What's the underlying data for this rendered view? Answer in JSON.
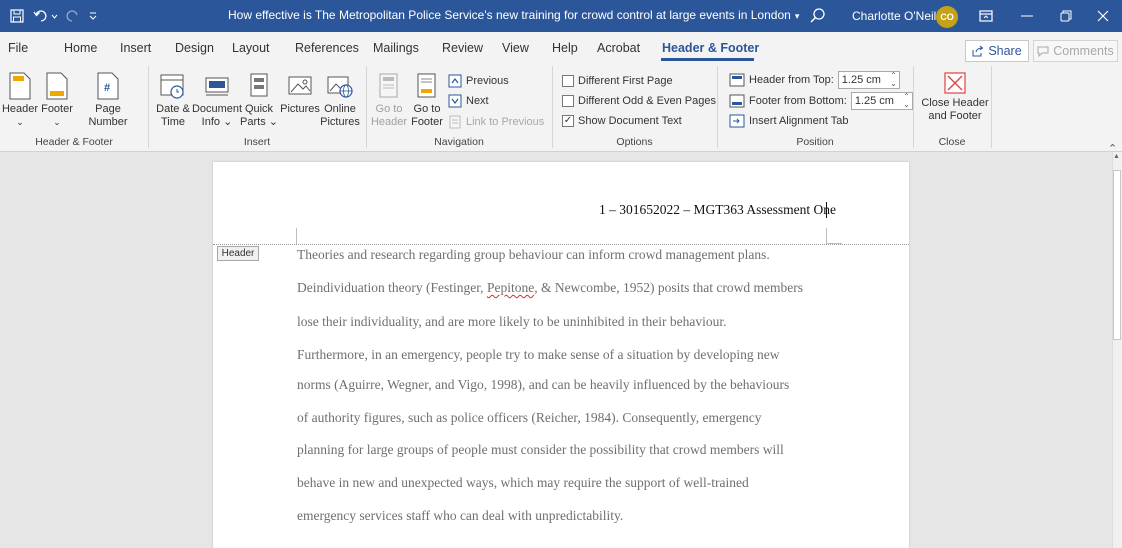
{
  "titlebar": {
    "doc_title": "How effective is The Metropolitan Police Service's new training for crowd control at large events in London",
    "user_name": "Charlotte O'Neill",
    "avatar_initials": "CO"
  },
  "tabs": [
    "File",
    "Home",
    "Insert",
    "Design",
    "Layout",
    "References",
    "Mailings",
    "Review",
    "View",
    "Help",
    "Acrobat",
    "Header & Footer"
  ],
  "active_tab": "Header & Footer",
  "share_label": "Share",
  "comments_label": "Comments",
  "ribbon": {
    "header_footer_group": {
      "label": "Header & Footer",
      "header": "Header",
      "footer": "Footer",
      "page_number_1": "Page",
      "page_number_2": "Number"
    },
    "insert_group": {
      "label": "Insert",
      "date_time_1": "Date &",
      "date_time_2": "Time",
      "doc_info_1": "Document",
      "doc_info_2": "Info",
      "quick_parts_1": "Quick",
      "quick_parts_2": "Parts",
      "pictures": "Pictures",
      "online_pictures_1": "Online",
      "online_pictures_2": "Pictures"
    },
    "navigation_group": {
      "label": "Navigation",
      "go_to_header_1": "Go to",
      "go_to_header_2": "Header",
      "go_to_footer_1": "Go to",
      "go_to_footer_2": "Footer",
      "previous": "Previous",
      "next": "Next",
      "link_to_previous": "Link to Previous"
    },
    "options_group": {
      "label": "Options",
      "different_first_page": "Different First Page",
      "different_odd_even": "Different Odd & Even Pages",
      "show_document_text": "Show Document Text",
      "show_document_text_checked": true
    },
    "position_group": {
      "label": "Position",
      "header_from_top": "Header from Top:",
      "header_from_top_value": "1.25 cm",
      "footer_from_bottom": "Footer from Bottom:",
      "footer_from_bottom_value": "1.25 cm",
      "insert_alignment_tab": "Insert Alignment Tab"
    },
    "close_group": {
      "label": "Close",
      "close_1": "Close Header",
      "close_2": "and Footer"
    }
  },
  "document": {
    "header_text": "1 – 301652022 – MGT363 Assessment One",
    "header_tag": "Header",
    "body_lines": [
      "Theories and research regarding group behaviour can inform crowd management plans.",
      "Deindividuation theory (Festinger, Pepitone, & Newcombe, 1952) posits that crowd members",
      "lose their individuality, and are more likely to be uninhibited in their behaviour.",
      "Furthermore, in an emergency, people try to make sense of a situation by developing new",
      "norms (Aguirre, Wegner, and Vigo, 1998), and can be heavily influenced by the behaviours",
      "of authority figures, such as police officers (Reicher, 1984).  Consequently, emergency",
      "planning for large groups of people must consider the possibility that crowd members will",
      "behave in new and unexpected ways, which may require the support of well-trained",
      "emergency services staff who can deal with unpredictability."
    ],
    "line2_parts": [
      "Deindividuation theory (Festinger, ",
      "Pepitone",
      ", & Newcombe, 1952) posits that crowd members"
    ]
  },
  "colors": {
    "accent": "#2b579a",
    "avatar": "#c8a216",
    "close_icon": "#e04040"
  }
}
